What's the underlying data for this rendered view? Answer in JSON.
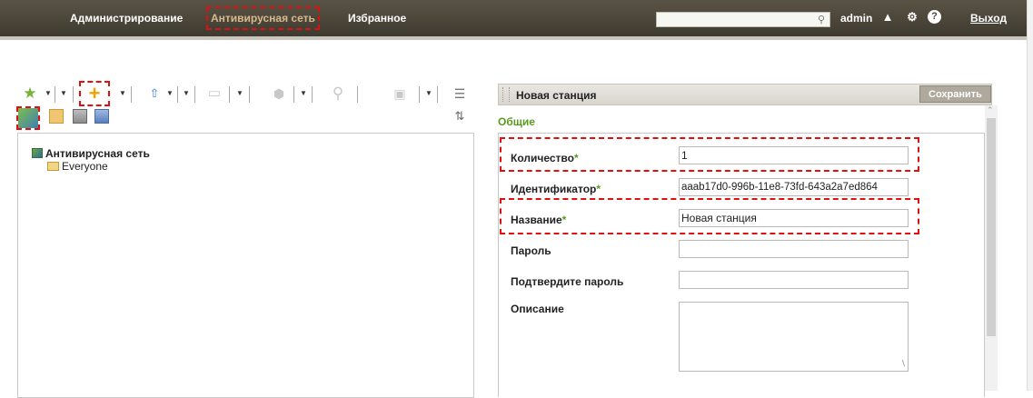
{
  "topbar": {
    "nav": [
      "Администрирование",
      "Антивирусная сеть",
      "Избранное"
    ],
    "user": "admin",
    "logout": "Выход",
    "search_placeholder": ""
  },
  "left": {
    "tree_root": "Антивирусная сеть",
    "tree_child": "Everyone"
  },
  "right": {
    "title": "Новая станция",
    "save_label": "Сохранить",
    "section": "Общие",
    "fields": {
      "count_label": "Количество",
      "count_value": "1",
      "id_label": "Идентификатор",
      "id_value": "aaab17d0-996b-11e8-73fd-643a2a7ed864",
      "name_label": "Название",
      "name_value": "Новая станция",
      "password_label": "Пароль",
      "confirm_label": "Подтвердите пароль",
      "description_label": "Описание",
      "required_mark": "*"
    }
  },
  "colors": {
    "topbar": "#4a4538",
    "active_nav": "#d8b98e",
    "required": "#5a9a1e",
    "highlight": "#e01010"
  }
}
